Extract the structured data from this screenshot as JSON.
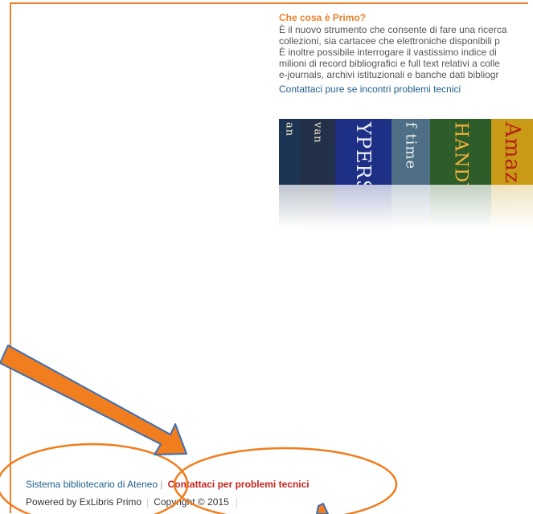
{
  "info": {
    "title": "Che cosa è Primo?",
    "lines": [
      "È il nuovo strumento che consente di fare una ricerca",
      "collezioni, sia cartacee che elettroniche disponibili p",
      "È inoltre possibile interrogare il vastissimo indice di",
      "milioni di record bibliografici e full text relativi a colle",
      "e-journals, archivi istituzionali e banche dati bibliogr"
    ],
    "contact_link": "Contattaci pure se incontri problemi tecnici"
  },
  "books": {
    "spines": [
      "an",
      "van",
      "YPERSPAC",
      "f time",
      "HANDY SC",
      "Amazing"
    ]
  },
  "footer": {
    "library_link": "Sistema bibliotecario di Ateneo",
    "contact_link": "Contattaci per problemi tecnici",
    "powered_by": "Powered by ExLibris Primo",
    "copyright": "Copyright © 2015"
  },
  "colors": {
    "accent_orange": "#e8822e",
    "link_blue": "#1f5f8b",
    "contact_red": "#c8201a"
  }
}
